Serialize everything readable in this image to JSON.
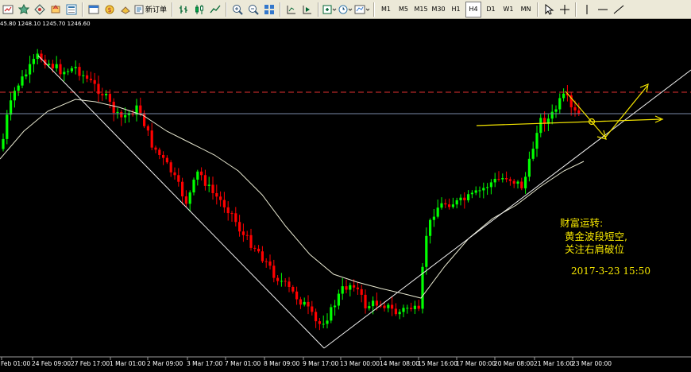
{
  "toolbar": {
    "new_order_label": "新订单",
    "timeframes": [
      "M1",
      "M5",
      "M15",
      "M30",
      "H1",
      "H4",
      "D1",
      "W1",
      "MN"
    ],
    "active_timeframe": "H4"
  },
  "chart": {
    "ohlc_text": "45.80 1248.10 1245.70 1246.60",
    "bg_color": "#000000",
    "bull_color": "#00ff00",
    "bear_color": "#ff0000",
    "ma_color": "#e8e8d0",
    "annotation_color": "#f5e600",
    "x_labels": [
      "Feb 01:00",
      "24 Feb 09:00",
      "27 Feb 17:00",
      "1 Mar 01:00",
      "2 Mar 09:00",
      "3 Mar 17:00",
      "7 Mar 01:00",
      "8 Mar 09:00",
      "9 Mar 17:00",
      "13 Mar 00:00",
      "14 Mar 08:00",
      "15 Mar 16:00",
      "17 Mar 00:00",
      "20 Mar 08:00",
      "21 Mar 16:00",
      "23 Mar 00:00"
    ]
  },
  "annotation": {
    "line1": "财富运转:",
    "line2": "黄金波段短空,",
    "line3": "关注右肩破位",
    "date": "2017-3-23 15:50"
  }
}
